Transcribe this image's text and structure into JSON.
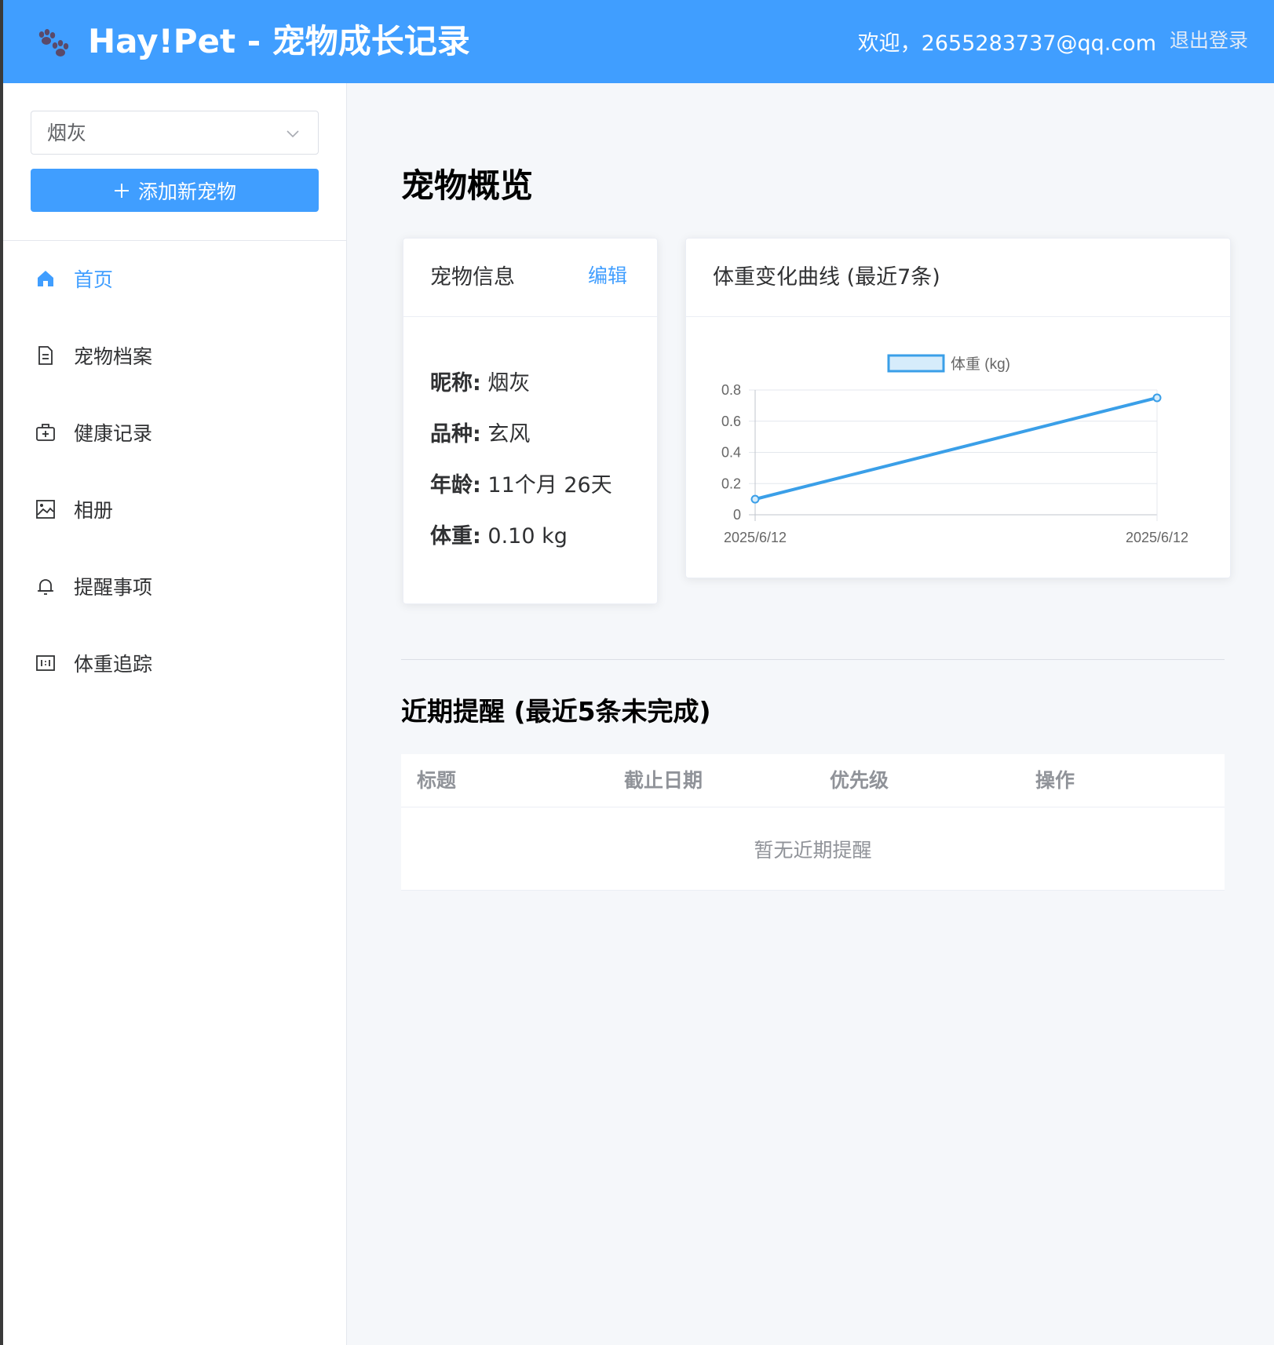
{
  "header": {
    "app_title": "Hay!Pet - 宠物成长记录",
    "welcome": "欢迎，2655283737@qq.com",
    "logout": "退出登录",
    "logo_icon": "paw-icon"
  },
  "sidebar": {
    "pet_select": {
      "value": "烟灰",
      "icon": "chevron-down-icon"
    },
    "add_pet_label": "添加新宠物",
    "add_pet_icon": "plus-icon",
    "menu": [
      {
        "label": "首页",
        "icon": "home-icon",
        "active": true
      },
      {
        "label": "宠物档案",
        "icon": "document-icon",
        "active": false
      },
      {
        "label": "健康记录",
        "icon": "medical-box-icon",
        "active": false
      },
      {
        "label": "相册",
        "icon": "picture-icon",
        "active": false
      },
      {
        "label": "提醒事项",
        "icon": "bell-icon",
        "active": false
      },
      {
        "label": "体重追踪",
        "icon": "scale-icon",
        "active": false
      }
    ]
  },
  "main": {
    "page_title": "宠物概览",
    "info_card": {
      "title": "宠物信息",
      "edit_label": "编辑",
      "rows": [
        {
          "label": "昵称:",
          "value": "烟灰"
        },
        {
          "label": "品种:",
          "value": "玄风"
        },
        {
          "label": "年龄:",
          "value": "11个月 26天"
        },
        {
          "label": "体重:",
          "value": "0.10 kg"
        }
      ]
    },
    "chart_card": {
      "title": "体重变化曲线 (最近7条)"
    },
    "reminders": {
      "title": "近期提醒 (最近5条未完成)",
      "columns": [
        "标题",
        "截止日期",
        "优先级",
        "操作"
      ],
      "empty_text": "暂无近期提醒"
    }
  },
  "colors": {
    "primary": "#409eff",
    "line": "#3a9fe8",
    "legend_fill": "#d6ecfb"
  },
  "chart_data": {
    "type": "line",
    "x": [
      "2025/6/12",
      "2025/6/12"
    ],
    "series": [
      {
        "name": "体重 (kg)",
        "values": [
          0.1,
          0.75
        ]
      }
    ],
    "yticks": [
      "0",
      "0.2",
      "0.4",
      "0.6",
      "0.8"
    ],
    "ylim": [
      0,
      0.8
    ],
    "grid": true,
    "legend": "top-center"
  }
}
